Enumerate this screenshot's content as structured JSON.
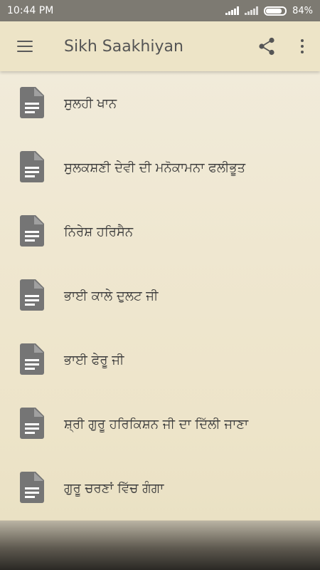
{
  "status_bar": {
    "time": "10:44 PM",
    "battery_percent": "84%",
    "battery_level": 0.84,
    "signal_icon": "cell-signal-icon",
    "battery_icon": "battery-icon"
  },
  "app_bar": {
    "title": "Sikh Saakhiyan",
    "menu_icon": "hamburger-menu-icon",
    "share_icon": "share-icon",
    "more_icon": "more-vertical-icon"
  },
  "items": [
    {
      "label": "ਸੁਲਹੀ ਖਾਨ",
      "icon": "document-icon"
    },
    {
      "label": "ਸੁਲਕਸ਼ਣੀ ਦੇਵੀ ਦੀ ਮਨੋਕਾਮਨਾ ਫਲੀਭੂਤ",
      "icon": "document-icon"
    },
    {
      "label": "ਨਿਰੇਸ਼ ਹਰਿਸੈਨ",
      "icon": "document-icon"
    },
    {
      "label": "ਭਾਈ ਕਾਲੇ ਦੁਲਟ ਜੀ",
      "icon": "document-icon"
    },
    {
      "label": "ਭਾਈ ਫੇਰੂ ਜੀ",
      "icon": "document-icon"
    },
    {
      "label": "ਸ਼੍ਰੀ ਗੁਰੂ ਹਰਿਕਿਸ਼ਨ ਜੀ ਦਾ ਦਿੱਲੀ ਜਾਣਾ",
      "icon": "document-icon"
    },
    {
      "label": "ਗੁਰੂ ਚਰਣਾਂ ਵਿੱਚ ਗੰਗਾ",
      "icon": "document-icon"
    }
  ],
  "colors": {
    "app_bar_bg": "#ede4c7",
    "icon_gray": "#757575",
    "text": "#3c3c3c",
    "status_bar_bg": "#7d7a72"
  }
}
